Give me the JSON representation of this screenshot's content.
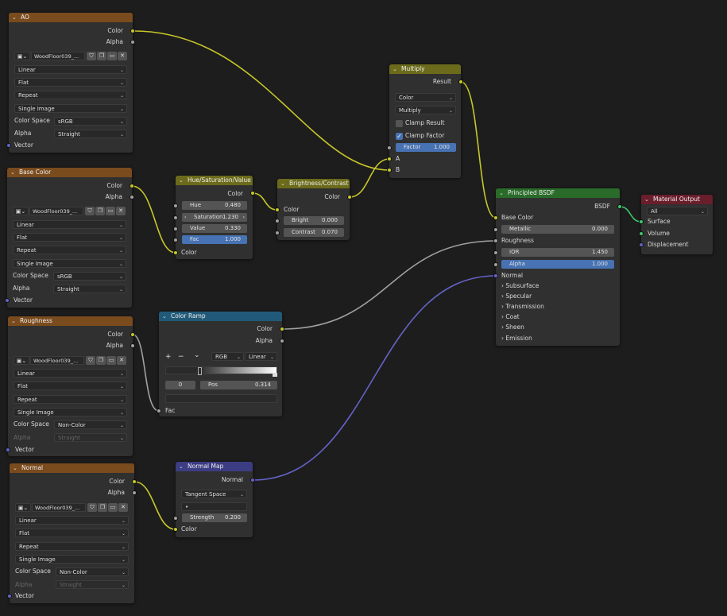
{
  "nodes": {
    "ao": {
      "title": "AO",
      "out_color": "Color",
      "out_alpha": "Alpha",
      "image": "WoodFloor039_...",
      "interpolation": "Linear",
      "projection": "Flat",
      "extension": "Repeat",
      "source": "Single Image",
      "color_space_label": "Color Space",
      "color_space": "sRGB",
      "alpha_label": "Alpha",
      "alpha_mode": "Straight",
      "in_vector": "Vector"
    },
    "base_color": {
      "title": "Base Color",
      "out_color": "Color",
      "out_alpha": "Alpha",
      "image": "WoodFloor039_...",
      "interpolation": "Linear",
      "projection": "Flat",
      "extension": "Repeat",
      "source": "Single Image",
      "color_space_label": "Color Space",
      "color_space": "sRGB",
      "alpha_label": "Alpha",
      "alpha_mode": "Straight",
      "in_vector": "Vector"
    },
    "roughness": {
      "title": "Roughness",
      "out_color": "Color",
      "out_alpha": "Alpha",
      "image": "WoodFloor039_...",
      "interpolation": "Linear",
      "projection": "Flat",
      "extension": "Repeat",
      "source": "Single Image",
      "color_space_label": "Color Space",
      "color_space": "Non-Color",
      "alpha_label": "Alpha",
      "alpha_mode": "Straight",
      "in_vector": "Vector"
    },
    "normal": {
      "title": "Normal",
      "out_color": "Color",
      "out_alpha": "Alpha",
      "image": "WoodFloor039_...",
      "interpolation": "Linear",
      "projection": "Flat",
      "extension": "Repeat",
      "source": "Single Image",
      "color_space_label": "Color Space",
      "color_space": "Non-Color",
      "alpha_label": "Alpha",
      "alpha_mode": "Straight",
      "in_vector": "Vector"
    },
    "hsv": {
      "title": "Hue/Saturation/Value",
      "out_color": "Color",
      "hue_label": "Hue",
      "hue": "0.480",
      "saturation_label": "Saturation",
      "saturation": "1.230",
      "value_label": "Value",
      "value": "0.330",
      "fac_label": "Fac",
      "fac": "1.000",
      "in_color": "Color"
    },
    "bc": {
      "title": "Brightness/Contrast",
      "out_color": "Color",
      "in_color": "Color",
      "bright_label": "Bright",
      "bright": "0.000",
      "contrast_label": "Contrast",
      "contrast": "0.070"
    },
    "multiply": {
      "title": "Multiply",
      "out_result": "Result",
      "data_type": "Color",
      "blend_mode": "Multiply",
      "clamp_result": "Clamp Result",
      "clamp_factor": "Clamp Factor",
      "factor_label": "Factor",
      "factor": "1.000",
      "in_a": "A",
      "in_b": "B"
    },
    "ramp": {
      "title": "Color Ramp",
      "out_color": "Color",
      "out_alpha": "Alpha",
      "add": "+",
      "remove": "−",
      "menu": "⌄",
      "color_mode": "RGB",
      "interp": "Linear",
      "index": "0",
      "pos_label": "Pos",
      "pos": "0.314",
      "in_fac": "Fac"
    },
    "normal_map": {
      "title": "Normal Map",
      "out_normal": "Normal",
      "space": "Tangent Space",
      "uv": "•",
      "strength_label": "Strength",
      "strength": "0.200",
      "in_color": "Color"
    },
    "bsdf": {
      "title": "Principled BSDF",
      "out_bsdf": "BSDF",
      "base_color": "Base Color",
      "metallic_label": "Metallic",
      "metallic": "0.000",
      "roughness": "Roughness",
      "ior_label": "IOR",
      "ior": "1.450",
      "alpha_label": "Alpha",
      "alpha": "1.000",
      "normal": "Normal",
      "subsurface": "Subsurface",
      "specular": "Specular",
      "transmission": "Transmission",
      "coat": "Coat",
      "sheen": "Sheen",
      "emission": "Emission"
    },
    "output": {
      "title": "Material Output",
      "target": "All",
      "surface": "Surface",
      "volume": "Volume",
      "displacement": "Displacement"
    }
  },
  "colors": {
    "background": "#1d1d1d",
    "texture_header": "#7a4b1d",
    "color_header": "#6b6b1b",
    "converter_header": "#215a78",
    "vector_header": "#3c3c83",
    "shader_header": "#2a6b2a",
    "output_header": "#6a1e2c",
    "socket_color": "#c7c729",
    "socket_float": "#a1a1a1",
    "socket_vector": "#6363c7",
    "socket_shader": "#3fc76a",
    "accent_blue": "#4772b3"
  }
}
